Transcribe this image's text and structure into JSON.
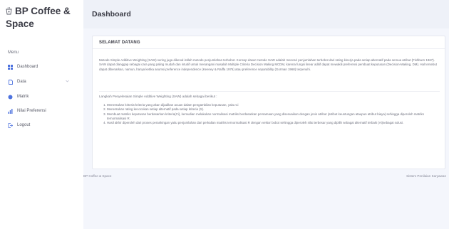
{
  "sidebar": {
    "brand": "BP Coffee & Space",
    "menu_heading": "Menu",
    "items": [
      {
        "label": "Dashboard",
        "icon": "grid-icon"
      },
      {
        "label": "Data",
        "icon": "file-icon",
        "has_chevron": true
      },
      {
        "label": "Matrik",
        "icon": "circle-icon"
      },
      {
        "label": "Nilai Preferensi",
        "icon": "bar-chart-icon"
      },
      {
        "label": "Logout",
        "icon": "logout-icon"
      }
    ]
  },
  "header": {
    "title": "Dashboard"
  },
  "card": {
    "title": "SELAMAT DATANG",
    "paragraph": "Metode Simple Additive Weighting (SAW) sering juga dikenal istilah metode penjumlahan terbobot. Konsep dasar metode SAW adalah mencari penjumlahan terbobot dari rating kinerja pada setiap alternatif pada semua atribut (Fishburn 1967). SAW dapat dianggap sebagai cara yang paling mudah dan intuitif untuk menangani masalah Multiple Criteria Decision Making MCDM, karena fungsi linear aditif dapat mewakili preferensi pembuat keputusan (Decision-Making, DM). Hal tersebut dapat dibenarkan, namun, hanya ketika asumsi preference independence (Keeney & Raiffa 1976) atau preference separability (Gorman 1968) terpenuhi.",
    "steps_intro": "Langkah Penyelesaian Simple Additive Weighting (SAW) adalah sebagai berikut :",
    "steps": [
      "Menentukan kriteria-kriteria yang akan dijadikan acuan dalam pengambilan keputusan, yaitu Ci",
      "Menentukan rating kecocokan setiap alternatif pada setiap kriteria (X).",
      "Membuat matriks keputusan berdasarkan kriteria(Ci), kemudian melakukan normalisasi matriks berdasarkan persamaan yang disesuaikan dengan jenis atribut (atribut keuntungan ataupun atribut biaya) sehingga diperoleh matriks ternormalisasi R.",
      "Hasil akhir diperoleh dari proses perankingan yaitu penjumlahan dari perkalian matriks ternormalisasi R dengan vektor bobot sehingga diperoleh nilai terbesar yang dipilih sebagai alternatif terbaik (Ai)sebagai solusi."
    ]
  },
  "footer": {
    "left": "BP Coffee & Space",
    "right": "Sistem Penilaian Karyawan"
  },
  "colors": {
    "accent": "#4e73df",
    "main_bg": "#f4f6fc",
    "heading": "#3a3b45"
  }
}
